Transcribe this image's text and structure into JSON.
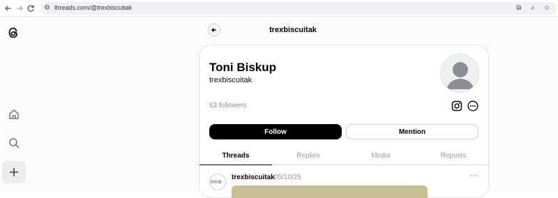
{
  "browser": {
    "url": "threads.com/@trexbiscuitak",
    "icons": [
      "back-arrow-icon",
      "forward-arrow-icon",
      "reload-icon",
      "site-settings-icon",
      "install-icon",
      "zoom-icon",
      "bookmark-star-icon"
    ]
  },
  "rail": {
    "icons": [
      "threads-logo-icon",
      "home-icon",
      "search-icon",
      "create-plus-icon"
    ]
  },
  "header": {
    "title": "trexbiscuitak"
  },
  "profile": {
    "name": "Toni Biskup",
    "handle": "trexbiscuitak",
    "followers": "63 followers",
    "follow_label": "Follow",
    "mention_label": "Mention"
  },
  "tabs": [
    {
      "label": "Threads",
      "active": true
    },
    {
      "label": "Replies",
      "active": false
    },
    {
      "label": "Media",
      "active": false
    },
    {
      "label": "Reposts",
      "active": false
    }
  ],
  "post": {
    "avatar_alt": "trexb",
    "username": "trexbiscuitak",
    "date": "05/10/25",
    "more": "···"
  },
  "colors": {
    "follow_bg": "#000000",
    "media_bg": "#c8bf95"
  }
}
